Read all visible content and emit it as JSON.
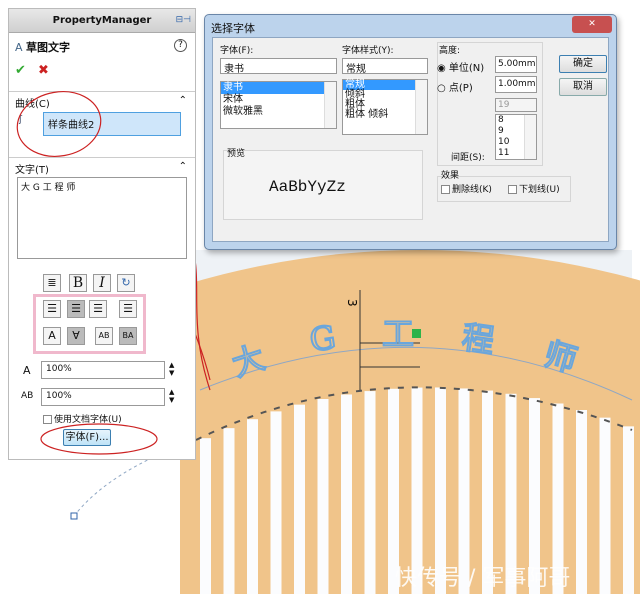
{
  "property_manager": {
    "title": "PropertyManager",
    "feature_title": "草图文字",
    "help": "?",
    "ok": "✔",
    "cancel": "✖",
    "curves_section": "曲线(C)",
    "curve_value": "样条曲线2",
    "text_section": "文字(T)",
    "text_value": "大 G 工 程 师",
    "width_factor": "100%",
    "spacing_factor": "100%",
    "use_doc_font": "使用文档字体(U)",
    "use_doc_font_checked": false,
    "font_button": "字体(F)..."
  },
  "dialog": {
    "title": "选择字体",
    "close": "✕",
    "font_label": "字体(F):",
    "font_value": "隶书",
    "font_list": [
      "隶书",
      "宋体",
      "微软雅黑"
    ],
    "style_label": "字体样式(Y):",
    "style_value": "常规",
    "style_list": [
      "常规",
      "倾斜",
      "粗体",
      "粗体 倾斜"
    ],
    "height_label": "高度:",
    "unit_radio": "单位(N)",
    "unit_value": "5.00mm",
    "point_radio": "点(P)",
    "point_value": "1.00mm",
    "point_size": "19",
    "point_list": [
      "8",
      "9",
      "10",
      "11"
    ],
    "spacing_label": "间距(S):",
    "preview_label": "预览",
    "preview_text": "AaBbYyZz",
    "effects_label": "效果",
    "strikeout": "删除线(K)",
    "underline": "下划线(U)",
    "ok": "确定",
    "cancel": "取消"
  },
  "canvas": {
    "sketch_text": [
      "大",
      "G",
      "工",
      "程",
      "师"
    ],
    "dimension": "3",
    "text_color": "#6aa6dc",
    "wood_color": "#f0c58a"
  },
  "watermark": "快传号 / 军事阿哥"
}
